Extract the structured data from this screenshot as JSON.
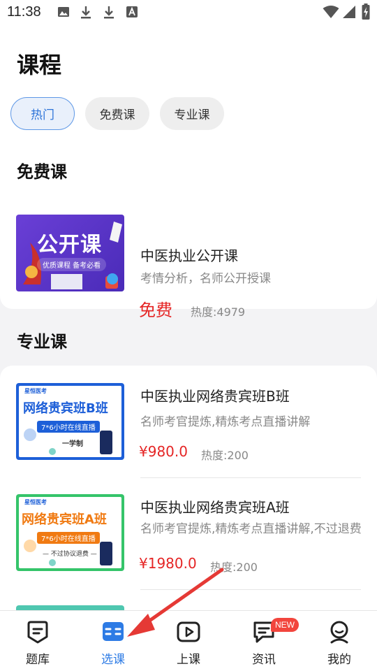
{
  "status_bar": {
    "time": "11:38"
  },
  "page": {
    "title": "课程"
  },
  "filters": [
    {
      "label": "热门",
      "active": true
    },
    {
      "label": "免费课",
      "active": false
    },
    {
      "label": "专业课",
      "active": false
    }
  ],
  "free_section": {
    "title": "免费课",
    "course": {
      "image_text": "公开课",
      "image_subtitle": "优质课程 备考必看",
      "title": "中医执业公开课",
      "desc": "考情分析，名师公开授课",
      "price": "免费",
      "heat": "热度:4979"
    }
  },
  "pro_section": {
    "title": "专业课",
    "courses": [
      {
        "brand": "星恒医考",
        "image_title": "网络贵宾班B班",
        "image_banner": "7*6小时在线直播",
        "image_note": "一学制",
        "title": "中医执业网络贵宾班B班",
        "desc": "名师考官提炼,精炼考点直播讲解",
        "price": "¥980.0",
        "heat": "热度:200"
      },
      {
        "brand": "星恒医考",
        "image_title": "网络贵宾班A班",
        "image_banner": "7*6小时在线直播",
        "image_note": "— 不过协议退费 —",
        "title": "中医执业网络贵宾班A班",
        "desc": "名师考官提炼,精炼考点直播讲解,不过退费",
        "price": "¥1980.0",
        "heat": "热度:200"
      }
    ]
  },
  "tabs": [
    {
      "label": "题库",
      "icon": "question-bank-icon",
      "active": false
    },
    {
      "label": "选课",
      "icon": "select-course-icon",
      "active": true
    },
    {
      "label": "上课",
      "icon": "play-class-icon",
      "active": false
    },
    {
      "label": "资讯",
      "icon": "news-icon",
      "active": false
    },
    {
      "label": "我的",
      "icon": "profile-icon",
      "active": false
    }
  ],
  "news_badge": "NEW",
  "colors": {
    "accent": "#2d7be5",
    "price": "#e52525",
    "active_chip_bg": "#e9f0fb",
    "badge": "#f2453d"
  }
}
